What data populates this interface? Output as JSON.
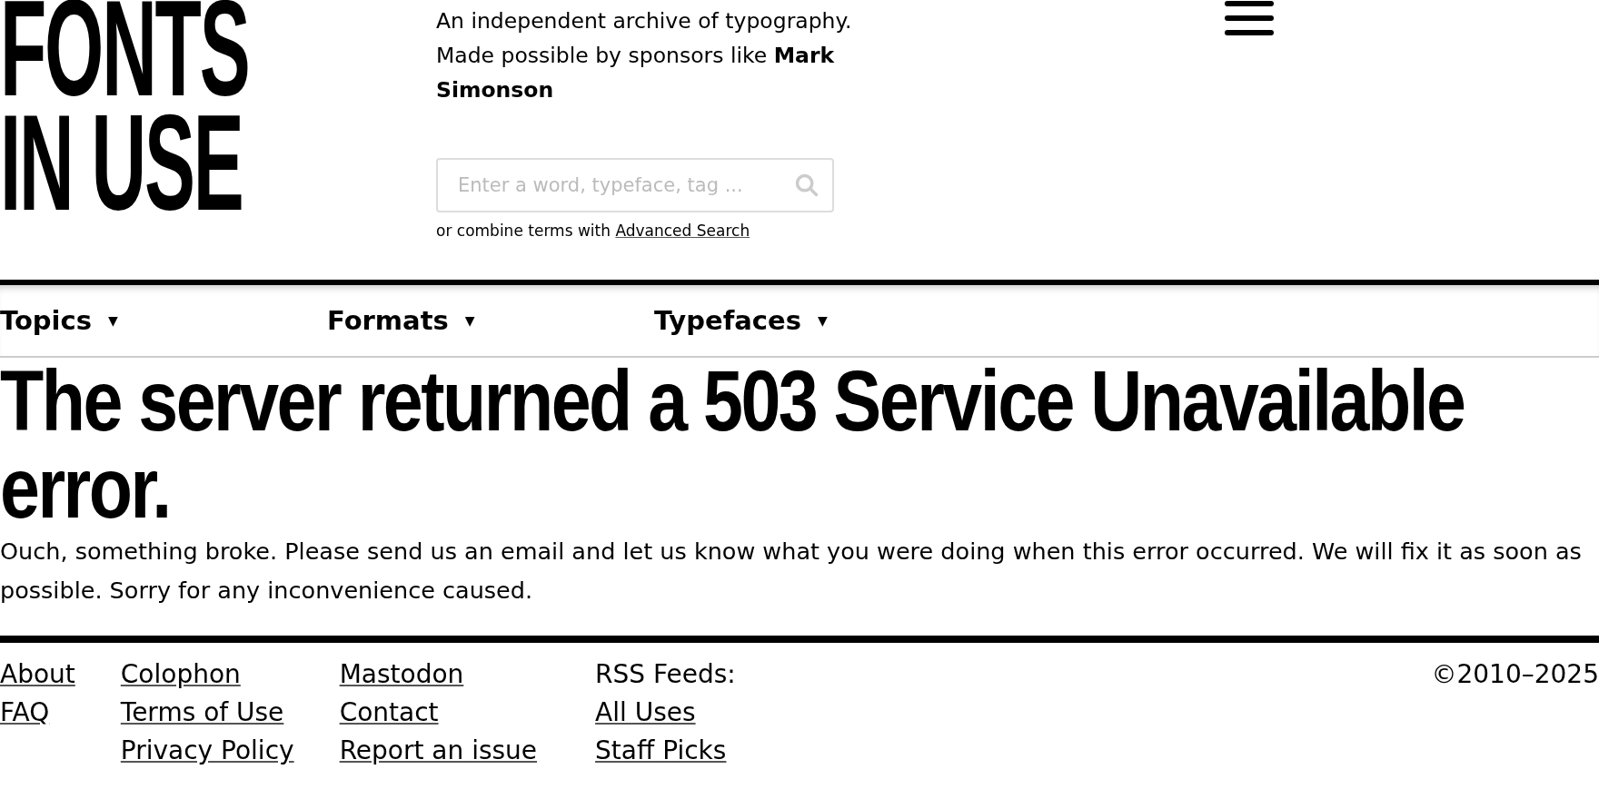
{
  "logo": {
    "lines": [
      "FONTS",
      "IN USE"
    ]
  },
  "tagline": {
    "text": "An independent archive of typography.",
    "sponsor_text": "Made possible by sponsors like **Mark Simonson**"
  },
  "search": {
    "placeholder": "Enter a word, typeface, tag ...",
    "hint": "or combine terms with",
    "advanced_link": "Advanced Search"
  },
  "nav": [
    {
      "label": "Topics",
      "caret": "▼"
    },
    {
      "label": "Formats",
      "caret": "▼"
    },
    {
      "label": "Typefaces",
      "caret": "▼"
    }
  ],
  "error": {
    "title": "The server returned a 503 Service Unavailable error.",
    "message": "Ouch, something broke. Please send us an email and let us know what you were doing when this error occurred. We will fix it as soon as possible. Sorry for any inconvenience caused."
  },
  "footer": {
    "columns": [
      {
        "links": [
          "About",
          "FAQ"
        ]
      },
      {
        "links": [
          "Colophon",
          "Terms of Use",
          "Privacy Policy"
        ]
      },
      {
        "links": [
          "Mastodon",
          "Contact",
          "Report an issue"
        ]
      },
      {
        "heading": "RSS Feeds:",
        "links": [
          "All Uses",
          "Staff Picks"
        ]
      }
    ],
    "copyright": "©2010–2025"
  }
}
